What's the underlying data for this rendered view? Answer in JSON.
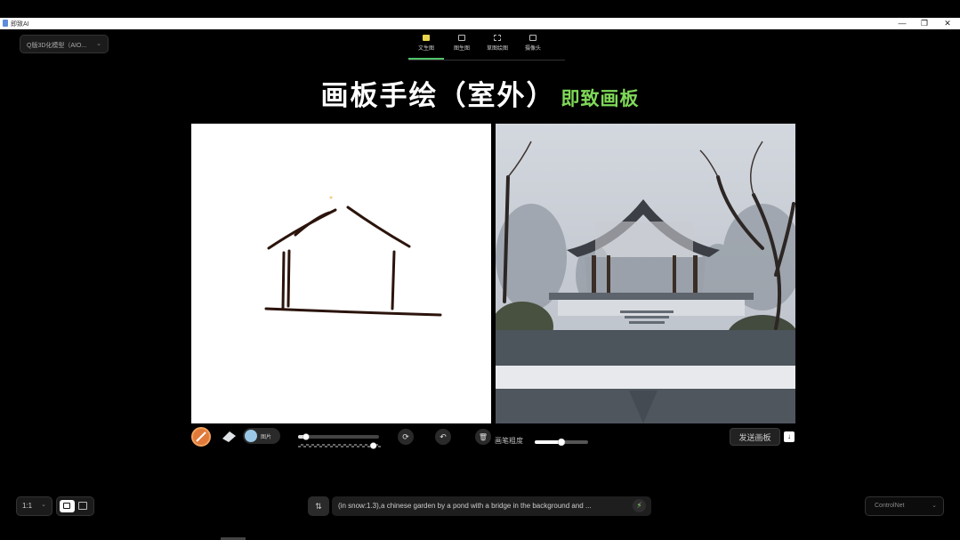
{
  "window": {
    "title": "即致AI",
    "minimize": "—",
    "maximize": "❐",
    "close": "✕"
  },
  "model_select": {
    "value": "Q版3D化模型（AIO...",
    "icon": "chevron-down-icon",
    "chev": "⌄"
  },
  "tabs": [
    {
      "label": "文生图",
      "active": true
    },
    {
      "label": "图生图",
      "active": false
    },
    {
      "label": "草图绘图",
      "active": false
    },
    {
      "label": "摄像头",
      "active": false
    }
  ],
  "headline": {
    "main": "画板手绘（室外）",
    "brand": "即致画板"
  },
  "toolbar": {
    "image_label": "图片",
    "rotate_icon": "⟳",
    "undo_icon": "↶",
    "delete_icon": "🗑",
    "thickness_label": "画笔粗度",
    "thickness_level": 0.5,
    "size_level": 0.08,
    "opacity_level": 0.95,
    "send_label": "发送画板",
    "download_icon": "↓"
  },
  "bottom": {
    "ratio": "1:1",
    "ratio_chev": "⌄",
    "prompt_settings_icon": "⇅",
    "prompt": "(in snow:1.3),a chinese garden by a pond with a bridge in the background and ...",
    "bolt_icon": "⚡",
    "controlnet": "ControlNet",
    "controlnet_chev": "⌄"
  },
  "colors": {
    "accent": "#4fc36a",
    "brand_green": "#7fd858",
    "sketch": "#2b140c",
    "brush": "#e07a3a"
  }
}
